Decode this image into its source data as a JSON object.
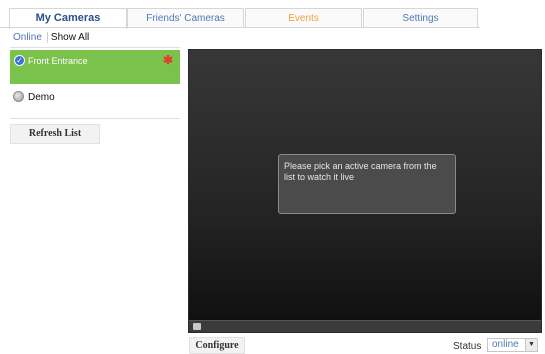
{
  "tabs": [
    {
      "label": "My Cameras",
      "active": true
    },
    {
      "label": "Friends' Cameras",
      "active": false
    },
    {
      "label": "Events",
      "active": false
    },
    {
      "label": "Settings",
      "active": false
    }
  ],
  "filter": {
    "online": "Online",
    "show_all": "Show All"
  },
  "cameras": [
    {
      "name": "Front Entrance",
      "selected": true
    },
    {
      "name": "Demo",
      "selected": false
    }
  ],
  "refresh_label": "Refresh List",
  "video": {
    "message": "Please pick an active camera from the list to watch it live"
  },
  "configure_label": "Configure",
  "status": {
    "label": "Status",
    "value": "online"
  },
  "colors": {
    "accent": "#2a4f8c",
    "link": "#4f79b4",
    "events_tab": "#f3a03c",
    "selected_bg": "#7bc24c",
    "star": "#e33c2d"
  },
  "icons": {
    "selected": "check-circle-icon",
    "offline": "grey-dot-icon",
    "favorite": "asterisk-icon",
    "dropdown": "chevron-down-icon"
  }
}
